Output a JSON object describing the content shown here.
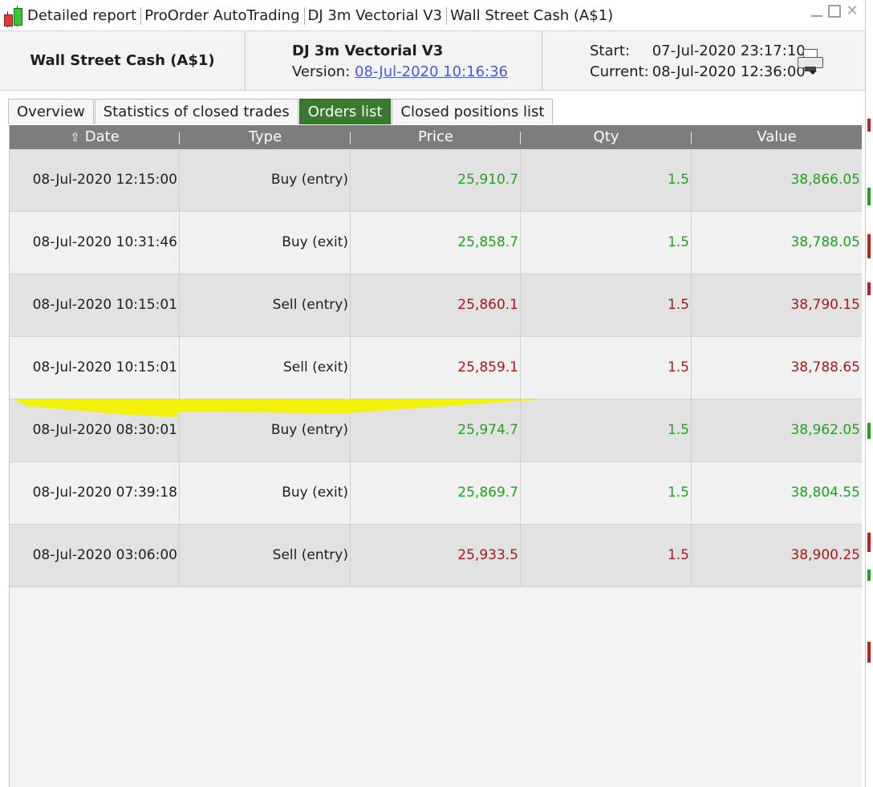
{
  "window": {
    "breadcrumbs": [
      "Detailed report",
      "ProOrder AutoTrading",
      "DJ 3m Vectorial V3",
      "Wall Street Cash (A$1)"
    ]
  },
  "header": {
    "instrument": "Wall Street Cash (A$1)",
    "strategy_name": "DJ 3m Vectorial V3",
    "version_label": "Version:",
    "version_link": "08-Jul-2020 10:16:36",
    "start_label": "Start:",
    "start_value": "07-Jul-2020 23:17:10",
    "current_label": "Current:",
    "current_value": "08-Jul-2020 12:36:00",
    "print_icon": "printer-icon"
  },
  "tabs": [
    {
      "label": "Overview",
      "active": false
    },
    {
      "label": "Statistics of closed trades",
      "active": false
    },
    {
      "label": "Orders list",
      "active": true
    },
    {
      "label": "Closed positions list",
      "active": false
    }
  ],
  "columns": [
    "Date",
    "Type",
    "Price",
    "Qty",
    "Value"
  ],
  "sort_icon": "arrow-up-icon",
  "orders": [
    {
      "date": "08-Jul-2020 12:15:00",
      "type": "Buy (entry)",
      "price": "25,910.7",
      "qty": "1.5",
      "value": "38,866.05",
      "side": "buy"
    },
    {
      "date": "08-Jul-2020 10:31:46",
      "type": "Buy (exit)",
      "price": "25,858.7",
      "qty": "1.5",
      "value": "38,788.05",
      "side": "buy"
    },
    {
      "date": "08-Jul-2020 10:15:01",
      "type": "Sell (entry)",
      "price": "25,860.1",
      "qty": "1.5",
      "value": "38,790.15",
      "side": "sell"
    },
    {
      "date": "08-Jul-2020 10:15:01",
      "type": "Sell (exit)",
      "price": "25,859.1",
      "qty": "1.5",
      "value": "38,788.65",
      "side": "sell"
    },
    {
      "date": "08-Jul-2020 08:30:01",
      "type": "Buy (entry)",
      "price": "25,974.7",
      "qty": "1.5",
      "value": "38,962.05",
      "side": "buy"
    },
    {
      "date": "08-Jul-2020 07:39:18",
      "type": "Buy (exit)",
      "price": "25,869.7",
      "qty": "1.5",
      "value": "38,804.55",
      "side": "buy"
    },
    {
      "date": "08-Jul-2020 03:06:00",
      "type": "Sell (entry)",
      "price": "25,933.5",
      "qty": "1.5",
      "value": "38,900.25",
      "side": "sell"
    }
  ],
  "colors": {
    "buy": "#1ba51b",
    "sell": "#b01616",
    "active_tab": "#3a7a2e",
    "header_bar": "#7d7d7d",
    "highlight": "#f2f200"
  }
}
